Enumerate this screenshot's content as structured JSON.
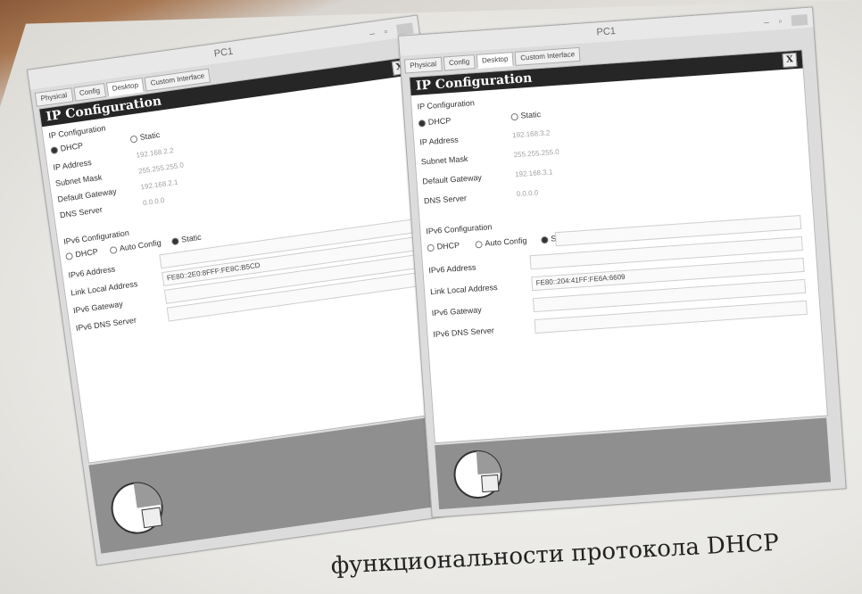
{
  "left": {
    "title": "PC1",
    "tabs": [
      "Physical",
      "Config",
      "Desktop",
      "Custom Interface"
    ],
    "cfg_title": "IP Configuration",
    "close": "X",
    "section": "IP Configuration",
    "dhcp": "DHCP",
    "static": "Static",
    "ip_label": "IP Address",
    "ip_value": "192.168.2.2",
    "mask_label": "Subnet Mask",
    "mask_value": "255.255.255.0",
    "gw_label": "Default Gateway",
    "gw_value": "192.168.2.1",
    "dns_label": "DNS Server",
    "dns_value": "0.0.0.0",
    "ipv6_section": "IPv6 Configuration",
    "ipv6_dhcp": "DHCP",
    "ipv6_auto": "Auto Config",
    "ipv6_static": "Static",
    "ipv6_addr_label": "IPv6 Address",
    "ipv6_addr_value": "",
    "ipv6_link_label": "Link Local Address",
    "ipv6_link_value": "FE80::2E0:8FFF:FE8C:B5CD",
    "ipv6_gw_label": "IPv6 Gateway",
    "ipv6_dns_label": "IPv6 DNS Server"
  },
  "right": {
    "title": "PC1",
    "tabs": [
      "Physical",
      "Config",
      "Desktop",
      "Custom Interface"
    ],
    "cfg_title": "IP Configuration",
    "close": "X",
    "section": "IP Configuration",
    "dhcp": "DHCP",
    "static": "Static",
    "ip_label": "IP Address",
    "ip_value": "192.168.3.2",
    "mask_label": "Subnet Mask",
    "mask_value": "255.255.255.0",
    "gw_label": "Default Gateway",
    "gw_value": "192.168.3.1",
    "dns_label": "DNS Server",
    "dns_value": "0.0.0.0",
    "ipv6_section": "IPv6 Configuration",
    "ipv6_dhcp": "DHCP",
    "ipv6_auto": "Auto Config",
    "ipv6_static": "Static",
    "ipv6_addr_label": "IPv6 Address",
    "ipv6_addr_value": "",
    "ipv6_link_label": "Link Local Address",
    "ipv6_link_value": "FE80::204:41FF:FE6A:6609",
    "ipv6_gw_label": "IPv6 Gateway",
    "ipv6_dns_label": "IPv6 DNS Server"
  },
  "caption": "функциональности протокола DHCP"
}
